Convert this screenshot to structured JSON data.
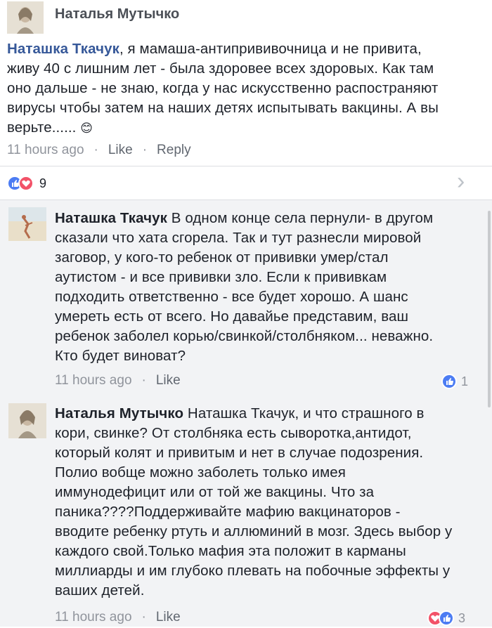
{
  "post": {
    "author": "Наталья Мутычко"
  },
  "comment1": {
    "mention": "Наташка Ткачук",
    "lines": [
      ", я мамаша-антипрививочница и не привита,",
      "живу 40 с лишним лет - была здоровее всех здоровых. Как там",
      "оно дальше - не знаю, когда у нас искусственно распостраняют",
      "вирусы чтобы затем на наших детях испытывать вакцины. А вы",
      "верьте......"
    ],
    "emoji": "😊",
    "time": "11 hours ago",
    "like": "Like",
    "reply": "Reply"
  },
  "reactions": {
    "count": "9",
    "chevron": "›"
  },
  "reply1": {
    "author": "Наташка Ткачук",
    "lines": [
      " В одном конце села пернули- в другом",
      "сказали что хата сгорела. Так и тут разнесли мировой",
      "заговор, у кого-то ребенок от прививки умер/стал",
      "аутистом - и все прививки зло. Если к прививкам",
      "подходить ответственно - все будет хорошо. А шанс",
      "умереть есть от всего. Но давайье представим, ваш",
      "ребенок заболел корью/свинкой/столбняком... неважно.",
      "Кто будет виноват?"
    ],
    "time": "11 hours ago",
    "like": "Like",
    "reaction_count": "1"
  },
  "reply2": {
    "author": "Наталья Мутычко",
    "lines": [
      " Наташка Ткачук, и что страшного в",
      "кори, свинке? От столбняка есть сыворотка,антидот,",
      "который колят и привитым и нет в случае подозрения.",
      "Полио вобще можно заболеть только имея",
      "иммунодефицит или от той же вакцины. Что за",
      "паника????Поддерживайте мафию вакцинаторов -",
      "вводите ребенку ртуть и аллюминий в мозг. Здесь выбор у",
      "каждого свой.Только мафия эта положит в карманы",
      "миллиарды и им глубоко плевать на побочные эффекты у",
      "ваших детей."
    ],
    "time": "11 hours ago",
    "like": "Like",
    "reaction_count": "3"
  },
  "colors": {
    "link": "#365899",
    "meta": "#90949c",
    "like": "#4c7cf3",
    "love": "#f25268",
    "reply_bg": "#f2f3f5"
  }
}
